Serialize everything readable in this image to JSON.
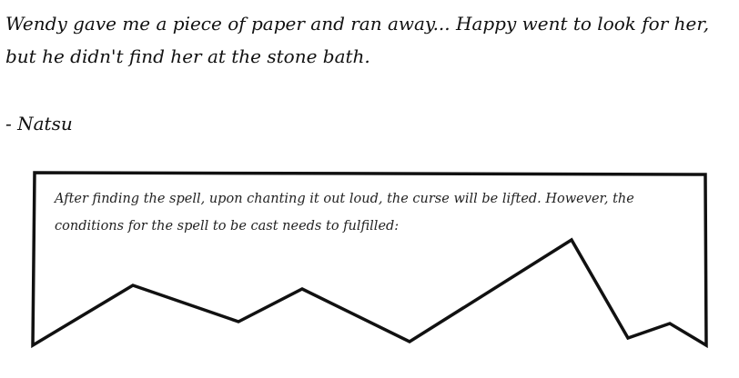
{
  "note": {
    "text": "Wendy gave me a piece of paper and ran away... Happy went to look for her, but he didn't find her at the stone bath."
  },
  "signature": "- Natsu",
  "paper": {
    "text": "After finding the spell, upon chanting it out loud, the curse will be lifted. However, the conditions for the spell to be cast needs to fulfilled:"
  }
}
